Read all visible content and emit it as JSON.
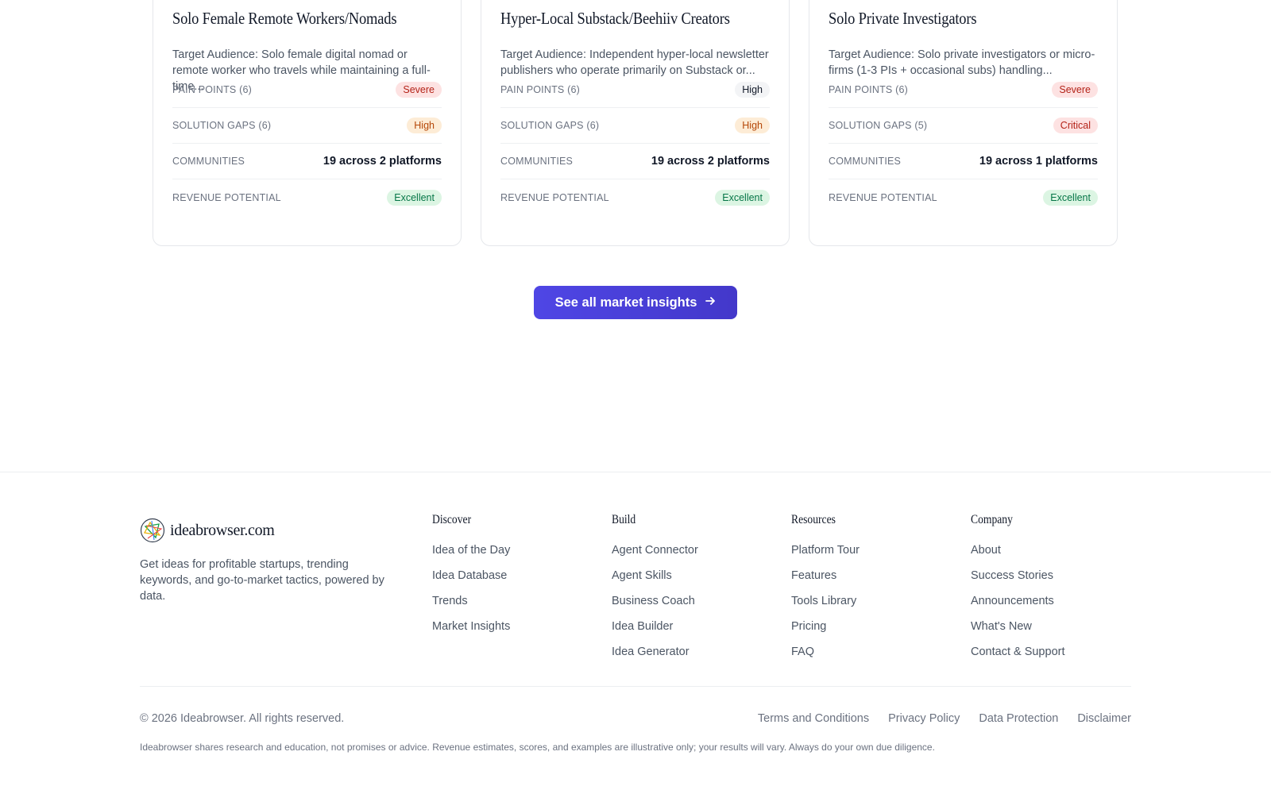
{
  "cards": [
    {
      "title": "Solo Female Remote Workers/Nomads",
      "description": "Target Audience: Solo female digital nomad or remote worker who travels while maintaining a full-time...",
      "metrics": {
        "pain_points": {
          "label": "PAIN POINTS (6)",
          "value": "Severe"
        },
        "solution_gaps": {
          "label": "SOLUTION GAPS (6)",
          "value": "High"
        },
        "communities": {
          "label": "COMMUNITIES",
          "value": "19 across 2 platforms"
        },
        "revenue": {
          "label": "REVENUE POTENTIAL",
          "value": "Excellent"
        }
      }
    },
    {
      "title": "Hyper-Local Substack/Beehiiv Creators",
      "description": "Target Audience: Independent hyper-local newsletter publishers who operate primarily on Substack or...",
      "metrics": {
        "pain_points": {
          "label": "PAIN POINTS (6)",
          "value": "High"
        },
        "solution_gaps": {
          "label": "SOLUTION GAPS (6)",
          "value": "High"
        },
        "communities": {
          "label": "COMMUNITIES",
          "value": "19 across 2 platforms"
        },
        "revenue": {
          "label": "REVENUE POTENTIAL",
          "value": "Excellent"
        }
      }
    },
    {
      "title": "Solo Private Investigators",
      "description": "Target Audience: Solo private investigators or micro-firms (1-3 PIs + occasional subs) handling...",
      "metrics": {
        "pain_points": {
          "label": "PAIN POINTS (6)",
          "value": "Severe"
        },
        "solution_gaps": {
          "label": "SOLUTION GAPS (5)",
          "value": "Critical"
        },
        "communities": {
          "label": "COMMUNITIES",
          "value": "19 across 1 platforms"
        },
        "revenue": {
          "label": "REVENUE POTENTIAL",
          "value": "Excellent"
        }
      }
    }
  ],
  "cta": {
    "label": "See all market insights",
    "icon": "arrow-right-icon"
  },
  "footer": {
    "brand": {
      "name": "ideabrowser.com",
      "tagline": "Get ideas for profitable startups, trending keywords, and go-to-market tactics, powered by data."
    },
    "columns": [
      {
        "title": "Discover",
        "links": [
          "Idea of the Day",
          "Idea Database",
          "Trends",
          "Market Insights"
        ]
      },
      {
        "title": "Build",
        "links": [
          "Agent Connector",
          "Agent Skills",
          "Business Coach",
          "Idea Builder",
          "Idea Generator"
        ]
      },
      {
        "title": "Resources",
        "links": [
          "Platform Tour",
          "Features",
          "Tools Library",
          "Pricing",
          "FAQ"
        ]
      },
      {
        "title": "Company",
        "links": [
          "About",
          "Success Stories",
          "Announcements",
          "What's New",
          "Contact & Support"
        ]
      }
    ],
    "copyright": "© 2026 Ideabrowser. All rights reserved.",
    "legal_links": [
      "Terms and Conditions",
      "Privacy Policy",
      "Data Protection",
      "Disclaimer"
    ],
    "disclaimer": "Ideabrowser shares research and education, not promises or advice. Revenue estimates, scores, and examples are illustrative only; your results will vary. Always do your own due diligence."
  },
  "colors": {
    "accent": "#4f46e5",
    "severe": "#b42318",
    "high": "#b54708",
    "excellent": "#067647"
  }
}
